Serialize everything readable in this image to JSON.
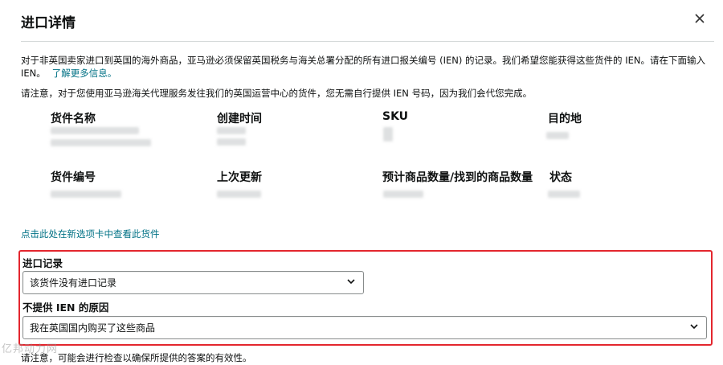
{
  "modal": {
    "title": "进口详情",
    "close_icon": "close-icon"
  },
  "intro": {
    "text": "对于非英国卖家进口到英国的海外商品，亚马逊必须保留英国税务与海关总署分配的所有进口报关编号 (IEN) 的记录。我们希望您能获得这些货件的 IEN。请在下面输入 IEN。",
    "learn_more": "了解更多信息。"
  },
  "notice": "请注意，对于您使用亚马逊海关代理服务发往我们的英国运营中心的货件，您无需自行提供 IEN 号码，因为我们会代您完成。",
  "fields": {
    "shipment_name": "货件名称",
    "created_time": "创建时间",
    "sku": "SKU",
    "destination": "目的地",
    "shipment_id": "货件编号",
    "last_updated": "上次更新",
    "quantity": "预计商品数量/找到的商品数量",
    "status": "状态"
  },
  "view_link": "点击此处在新选项卡中查看此货件",
  "import_record": {
    "label": "进口记录",
    "selected": "该货件没有进口记录"
  },
  "reason": {
    "label": "不提供 IEN 的原因",
    "selected": "我在英国国内购买了这些商品"
  },
  "footer_note": "请注意，可能会进行检查以确保所提供的答案的有效性。",
  "watermark": "亿邦动力网",
  "colors": {
    "link": "#007185",
    "highlight_border": "#e3262e",
    "divider": "#d5d9d9"
  }
}
